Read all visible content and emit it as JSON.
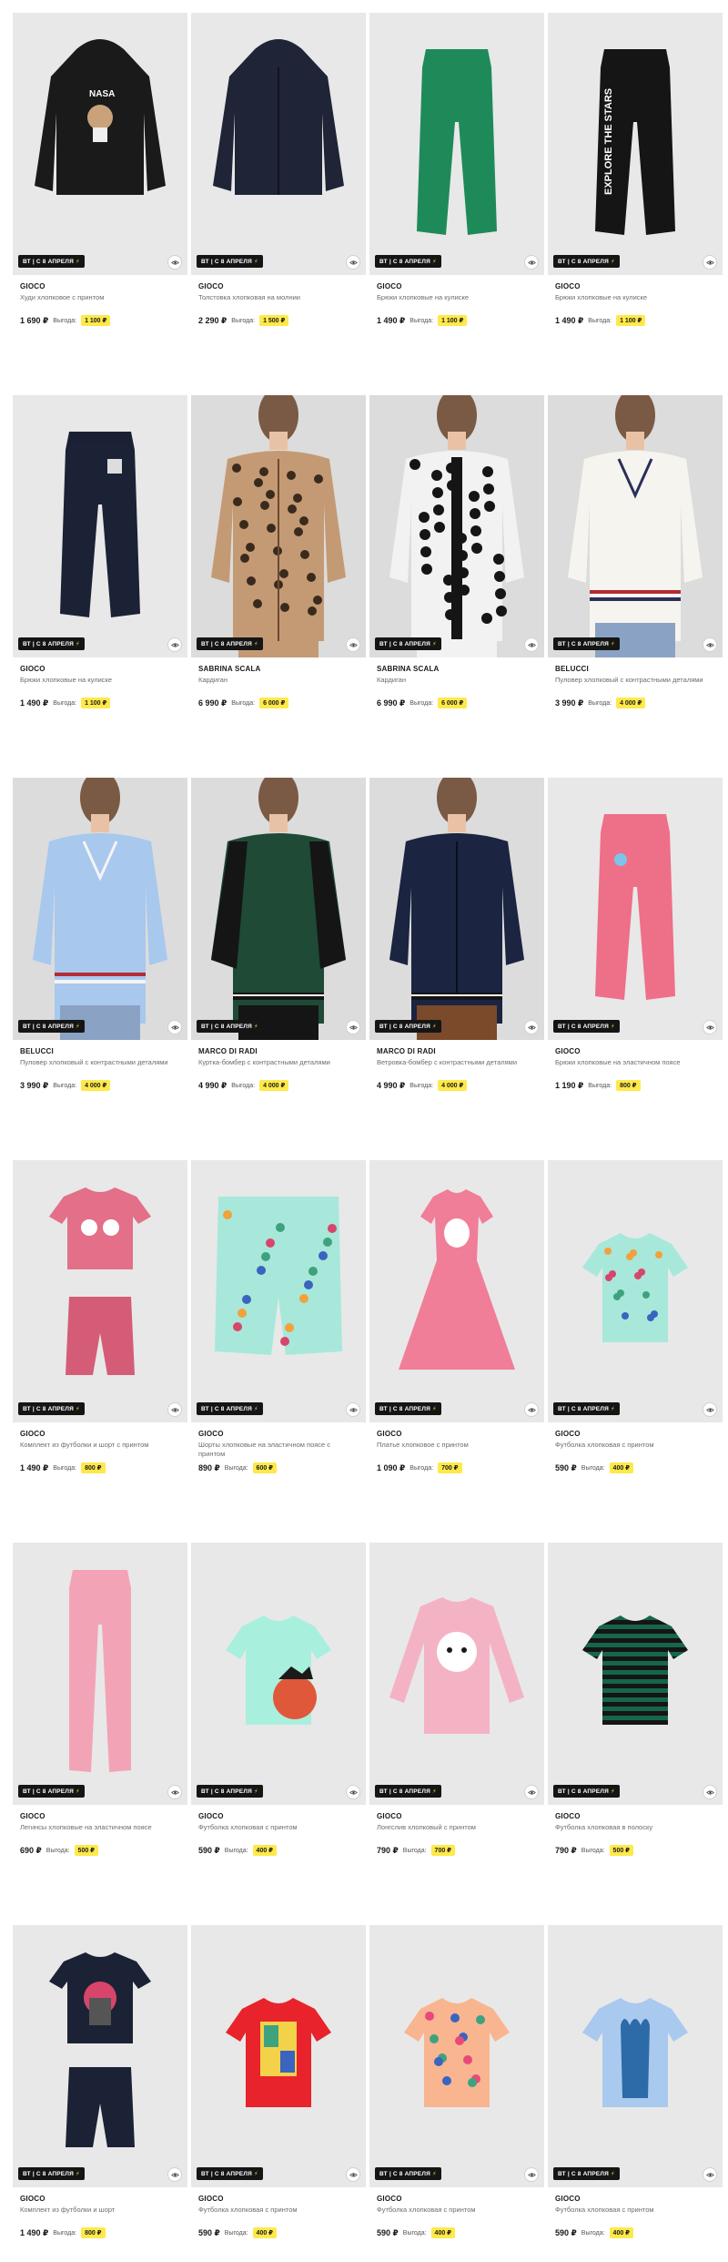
{
  "promo_label": "ВТ | С 8 АПРЕЛЯ",
  "benefit_label": "Выгода:",
  "colors": {
    "benefit_bg": "#ffe94a",
    "promo_bg": "#151515",
    "photo_bg": "#e8e8e8"
  },
  "products": [
    {
      "brand": "GIOCO",
      "name": "Худи хлопковое с принтом",
      "price": "1 690 ₽",
      "benefit": "1 100 ₽",
      "art": "hoodie-black"
    },
    {
      "brand": "GIOCO",
      "name": "Толстовка хлопковая на молнии",
      "price": "2 290 ₽",
      "benefit": "1 500 ₽",
      "art": "zip-hoodie-navy"
    },
    {
      "brand": "GIOCO",
      "name": "Брюки хлопковые на кулиске",
      "price": "1 490 ₽",
      "benefit": "1 100 ₽",
      "art": "pants-green"
    },
    {
      "brand": "GIOCO",
      "name": "Брюки хлопковые на кулиске",
      "price": "1 490 ₽",
      "benefit": "1 100 ₽",
      "art": "pants-black-text"
    },
    {
      "brand": "GIOCO",
      "name": "Брюки хлопковые на кулиске",
      "price": "1 490 ₽",
      "benefit": "1 100 ₽",
      "art": "pants-navy"
    },
    {
      "brand": "SABRINA SCALA",
      "name": "Кардиган",
      "price": "6 990 ₽",
      "benefit": "6 000 ₽",
      "art": "cardigan-leopard-tan"
    },
    {
      "brand": "SABRINA SCALA",
      "name": "Кардиган",
      "price": "6 990 ₽",
      "benefit": "6 000 ₽",
      "art": "cardigan-leopard-bw"
    },
    {
      "brand": "BELUCCI",
      "name": "Пуловер хлопковый с контрастными деталями",
      "price": "3 990 ₽",
      "benefit": "4 000 ₽",
      "art": "sweater-white"
    },
    {
      "brand": "BELUCCI",
      "name": "Пуловер хлопковый с контрастными деталями",
      "price": "3 990 ₽",
      "benefit": "4 000 ₽",
      "art": "sweater-blue"
    },
    {
      "brand": "MARCO DI RADI",
      "name": "Куртка-бомбер с контрастными деталями",
      "price": "4 990 ₽",
      "benefit": "4 000 ₽",
      "art": "bomber-green"
    },
    {
      "brand": "MARCO DI RADI",
      "name": "Ветровка-бомбер с контрастными деталями",
      "price": "4 990 ₽",
      "benefit": "4 000 ₽",
      "art": "bomber-navy"
    },
    {
      "brand": "GIOCO",
      "name": "Брюки хлопковые на эластичном поясе",
      "price": "1 190 ₽",
      "benefit": "800 ₽",
      "art": "pants-pink"
    },
    {
      "brand": "GIOCO",
      "name": "Комплект из футболки и шорт с принтом",
      "price": "1 490 ₽",
      "benefit": "800 ₽",
      "art": "set-pink"
    },
    {
      "brand": "GIOCO",
      "name": "Шорты хлопковые на эластичном поясе с принтом",
      "price": "890 ₽",
      "benefit": "600 ₽",
      "art": "shorts-mint"
    },
    {
      "brand": "GIOCO",
      "name": "Платье хлопковое с принтом",
      "price": "1 090 ₽",
      "benefit": "700 ₽",
      "art": "dress-pink"
    },
    {
      "brand": "GIOCO",
      "name": "Футболка хлопковая с принтом",
      "price": "590 ₽",
      "benefit": "400 ₽",
      "art": "tee-mint-floral"
    },
    {
      "brand": "GIOCO",
      "name": "Легинсы хлопковые на эластичном поясе",
      "price": "690 ₽",
      "benefit": "500 ₽",
      "art": "leggings-pink"
    },
    {
      "brand": "GIOCO",
      "name": "Футболка хлопковая с принтом",
      "price": "590 ₽",
      "benefit": "400 ₽",
      "art": "tee-mint-cat"
    },
    {
      "brand": "GIOCO",
      "name": "Лонгслив хлопковый с принтом",
      "price": "790 ₽",
      "benefit": "700 ₽",
      "art": "longsleeve-pink"
    },
    {
      "brand": "GIOCO",
      "name": "Футболка хлопковая в полоску",
      "price": "790 ₽",
      "benefit": "500 ₽",
      "art": "tee-stripe"
    },
    {
      "brand": "GIOCO",
      "name": "Комплект из футболки и шорт",
      "price": "1 490 ₽",
      "benefit": "800 ₽",
      "art": "set-navy"
    },
    {
      "brand": "GIOCO",
      "name": "Футболка хлопковая с принтом",
      "price": "590 ₽",
      "benefit": "400 ₽",
      "art": "tee-red-dino"
    },
    {
      "brand": "GIOCO",
      "name": "Футболка хлопковая с принтом",
      "price": "590 ₽",
      "benefit": "400 ₽",
      "art": "tee-peach"
    },
    {
      "brand": "GIOCO",
      "name": "Футболка хлопковая с принтом",
      "price": "590 ₽",
      "benefit": "400 ₽",
      "art": "tee-blue-tulip"
    }
  ]
}
